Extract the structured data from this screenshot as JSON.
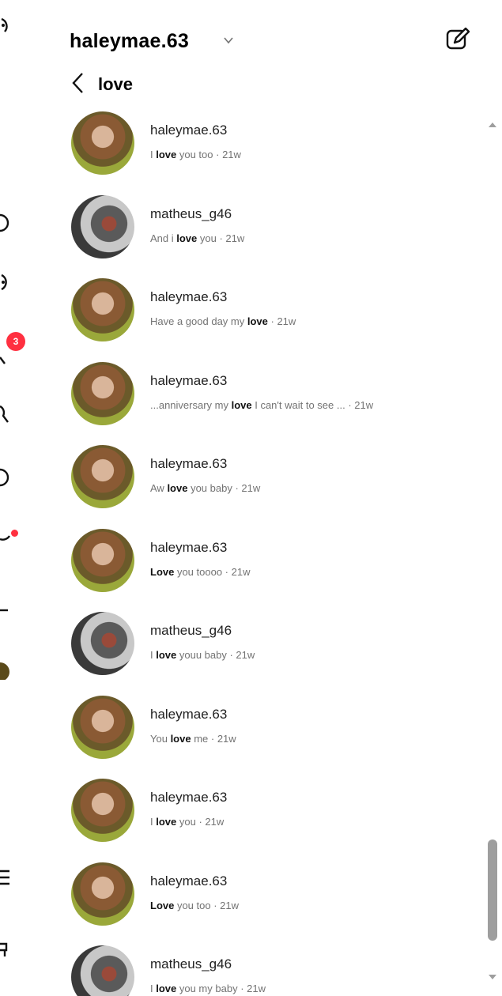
{
  "header": {
    "account": "haleymae.63"
  },
  "search": {
    "query": "love"
  },
  "nav": {
    "badge_count": "3"
  },
  "results": [
    {
      "user": "haleymae.63",
      "avatar": "haley",
      "pre": "I ",
      "hit": "love",
      "post": " you too",
      "time": "21w"
    },
    {
      "user": "matheus_g46",
      "avatar": "matheus",
      "pre": "And i ",
      "hit": "love",
      "post": " you",
      "time": "21w"
    },
    {
      "user": "haleymae.63",
      "avatar": "haley",
      "pre": "Have a good day my ",
      "hit": "love",
      "post": "",
      "time": "21w"
    },
    {
      "user": "haleymae.63",
      "avatar": "haley",
      "pre": "...anniversary my ",
      "hit": "love",
      "post": " I can't wait to see ...",
      "time": "21w"
    },
    {
      "user": "haleymae.63",
      "avatar": "haley",
      "pre": "Aw ",
      "hit": "love",
      "post": " you baby",
      "time": "21w"
    },
    {
      "user": "haleymae.63",
      "avatar": "haley",
      "pre": "",
      "hit": "Love",
      "post": " you toooo",
      "time": "21w"
    },
    {
      "user": "matheus_g46",
      "avatar": "matheus",
      "pre": "I ",
      "hit": "love",
      "post": " youu baby",
      "time": "21w"
    },
    {
      "user": "haleymae.63",
      "avatar": "haley",
      "pre": "You ",
      "hit": "love",
      "post": " me",
      "time": "21w"
    },
    {
      "user": "haleymae.63",
      "avatar": "haley",
      "pre": "I ",
      "hit": "love",
      "post": " you",
      "time": "21w"
    },
    {
      "user": "haleymae.63",
      "avatar": "haley",
      "pre": "",
      "hit": "Love",
      "post": " you too",
      "time": "21w"
    },
    {
      "user": "matheus_g46",
      "avatar": "matheus",
      "pre": "I ",
      "hit": "love",
      "post": " you my baby",
      "time": "21w"
    }
  ]
}
